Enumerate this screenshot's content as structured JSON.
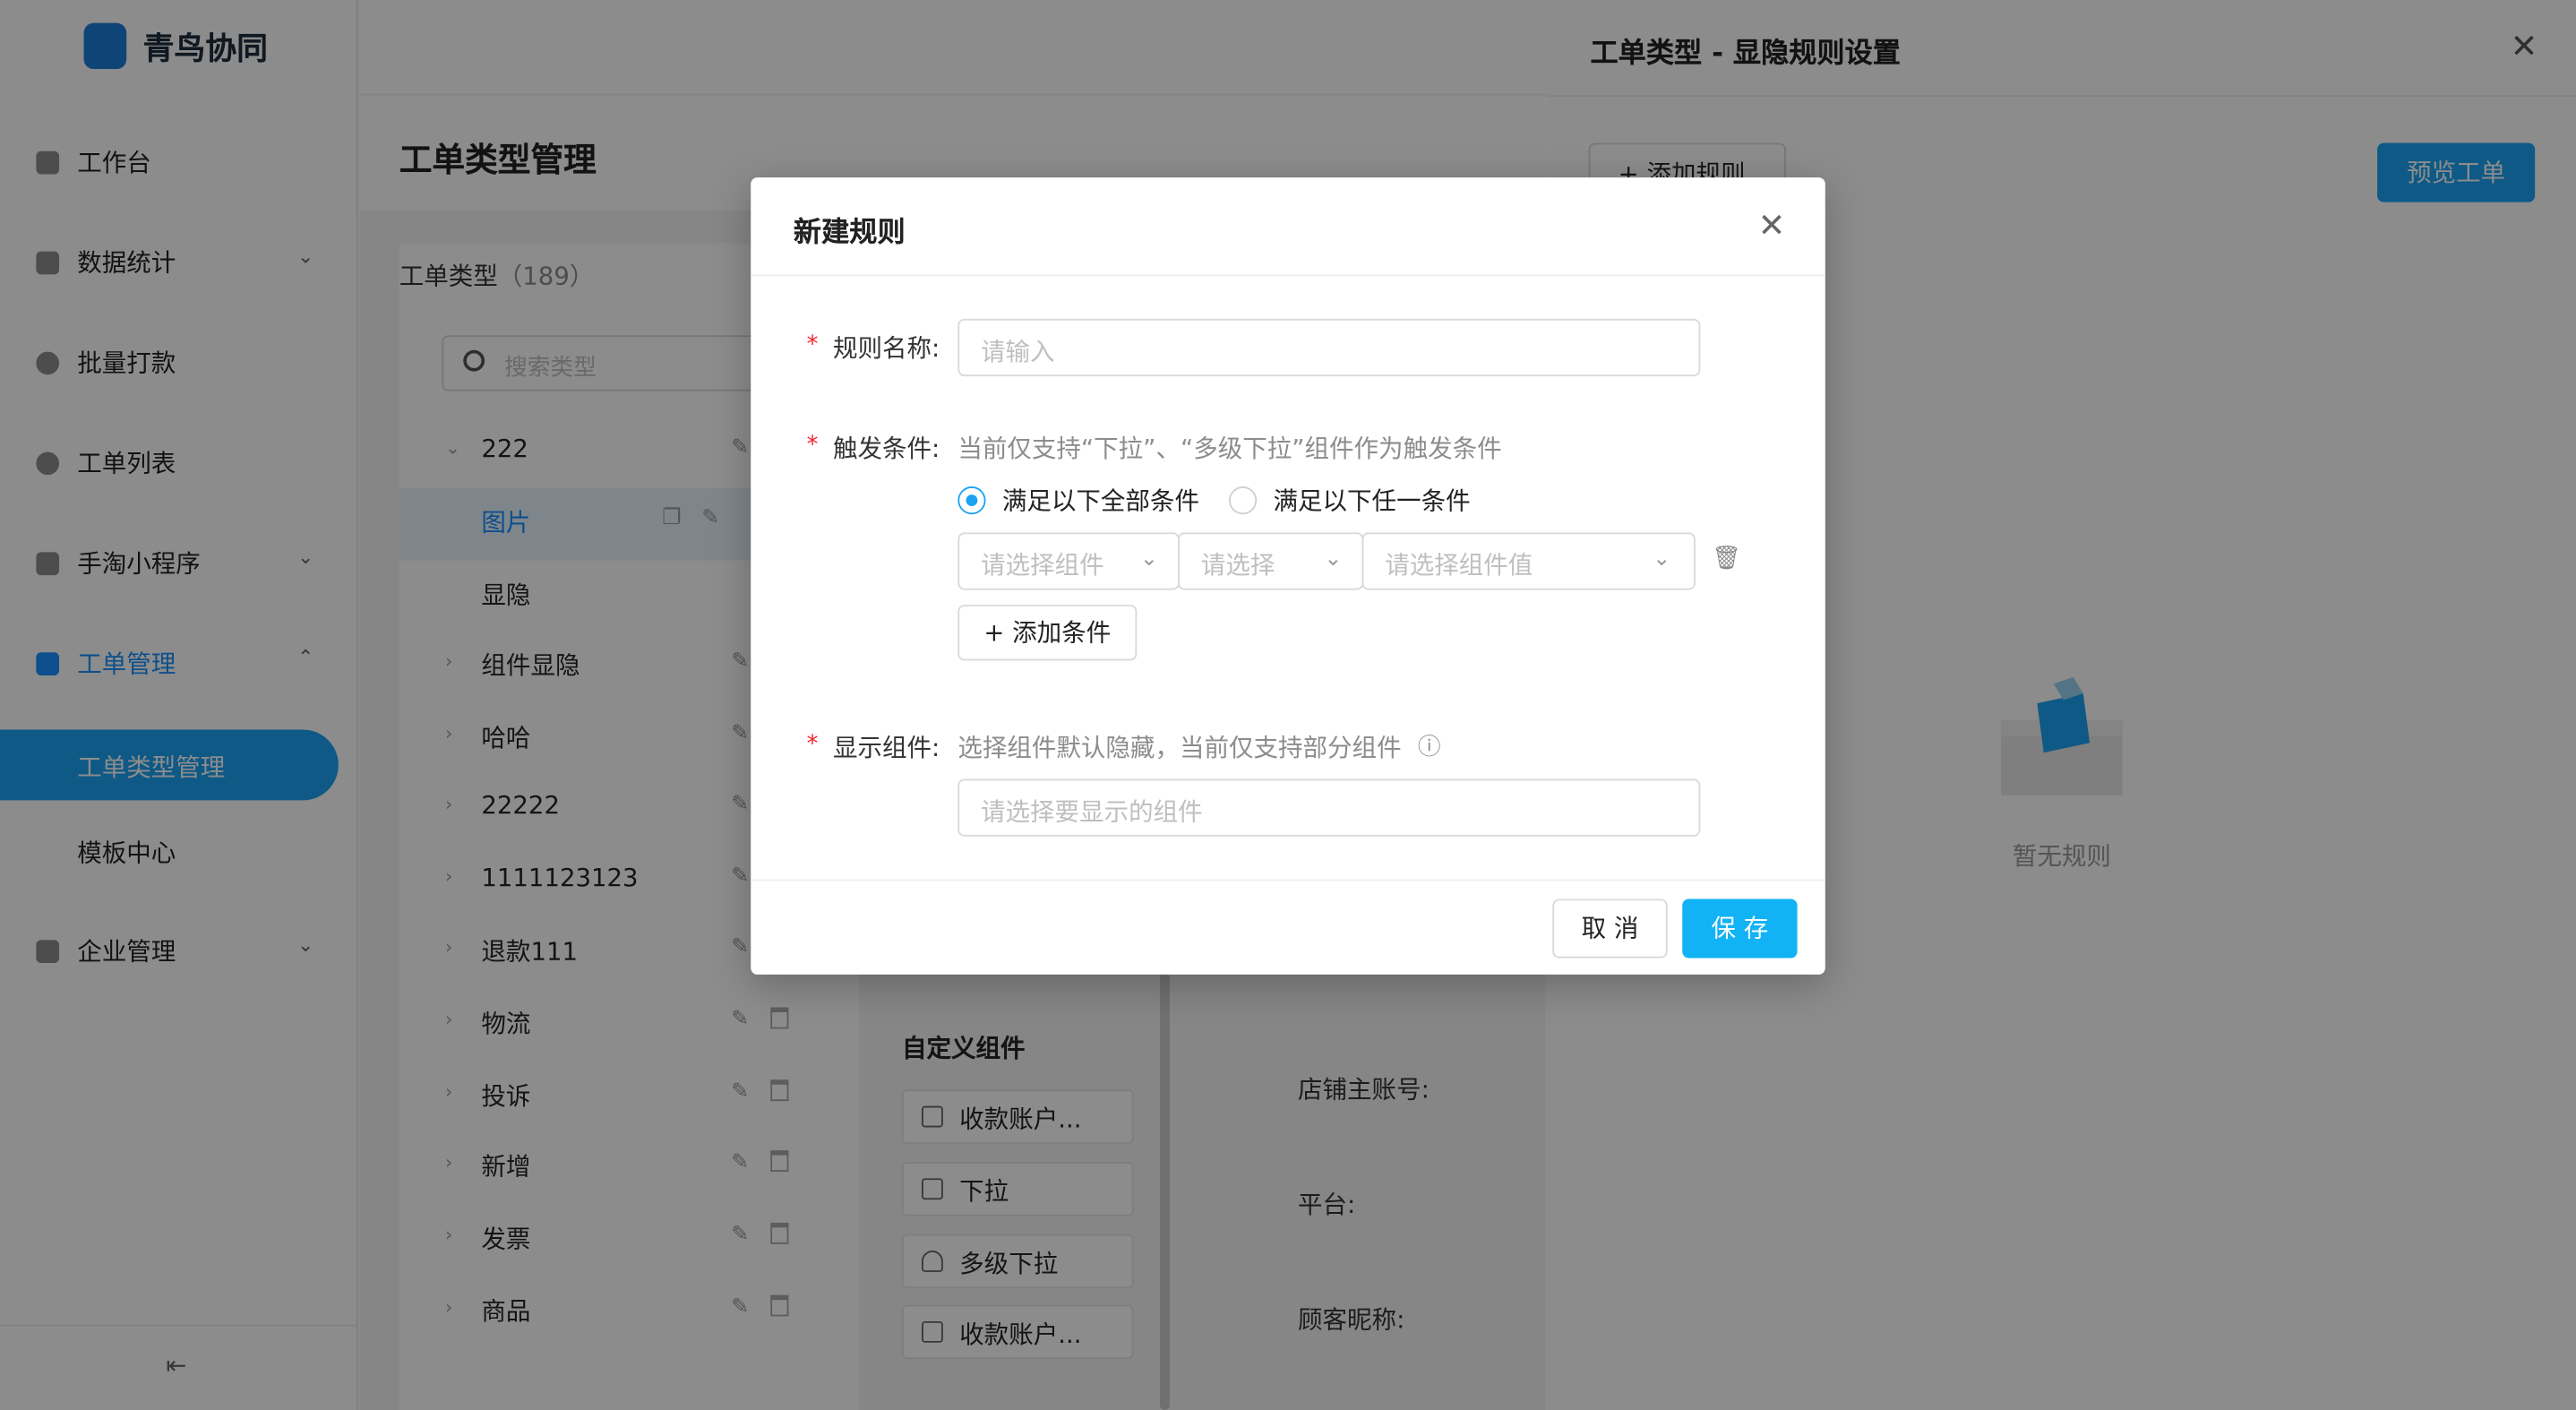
{
  "app": {
    "name": "青鸟协同"
  },
  "sidebar": {
    "items": [
      {
        "label": "工作台"
      },
      {
        "label": "数据统计",
        "chevron": "⌄"
      },
      {
        "label": "批量打款"
      },
      {
        "label": "工单列表"
      },
      {
        "label": "手淘小程序",
        "chevron": "⌄"
      },
      {
        "label": "工单管理",
        "chevron": "⌃"
      },
      {
        "label": "企业管理",
        "chevron": "⌄"
      }
    ],
    "sub_items": [
      {
        "label": "工单类型管理"
      },
      {
        "label": "模板中心"
      }
    ],
    "collapse_icon": "⇤"
  },
  "main": {
    "title": "工单类型管理",
    "type_list_title": "工单类型",
    "type_list_count": "（189）",
    "search_placeholder": "搜索类型",
    "types": [
      {
        "name": "222",
        "arrow": "⌄"
      },
      {
        "name": "图片",
        "arrow": ""
      },
      {
        "name": "显隐",
        "arrow": ""
      },
      {
        "name": "组件显隐",
        "arrow": "›"
      },
      {
        "name": "哈哈",
        "arrow": "›"
      },
      {
        "name": "22222",
        "arrow": "›"
      },
      {
        "name": "1111123123",
        "arrow": "›"
      },
      {
        "name": "退款111",
        "arrow": "›"
      },
      {
        "name": "物流",
        "arrow": "›"
      },
      {
        "name": "投诉",
        "arrow": "›"
      },
      {
        "name": "新增",
        "arrow": "›"
      },
      {
        "name": "发票",
        "arrow": "›"
      },
      {
        "name": "商品",
        "arrow": "›"
      }
    ],
    "custom_components_title": "自定义组件",
    "components": [
      {
        "label": "收款账户..."
      },
      {
        "label": "下拉"
      },
      {
        "label": "多级下拉"
      },
      {
        "label": "收款账户..."
      }
    ],
    "form_labels": [
      "店铺主账号:",
      "平台:",
      "顾客昵称:"
    ]
  },
  "drawer": {
    "title": "工单类型 - 显隐规则设置",
    "close_icon": "✕",
    "add_rule_label": "+ 添加规则",
    "preview_label": "预览工单",
    "empty_text": "暂无规则"
  },
  "modal": {
    "title": "新建规则",
    "close_icon": "✕",
    "required_mark": "*",
    "rule_name_label": "规则名称:",
    "rule_name_placeholder": "请输入",
    "trigger_label": "触发条件:",
    "trigger_hint": "当前仅支持“下拉”、“多级下拉”组件作为触发条件",
    "radio_all": "满足以下全部条件",
    "radio_any": "满足以下任一条件",
    "select_component_placeholder": "请选择组件",
    "select_operator_placeholder": "请选择",
    "select_value_placeholder": "请选择组件值",
    "add_condition_label": "+ 添加条件",
    "display_label": "显示组件:",
    "display_hint": "选择组件默认隐藏，当前仅支持部分组件",
    "info_icon": "ⓘ",
    "display_placeholder": "请选择要显示的组件",
    "cancel_label": "取 消",
    "save_label": "保 存",
    "trash_icon": "🗑",
    "chevron": "⌄"
  },
  "colors": {
    "accent": "#1aa2f5",
    "required": "#f5222d"
  }
}
